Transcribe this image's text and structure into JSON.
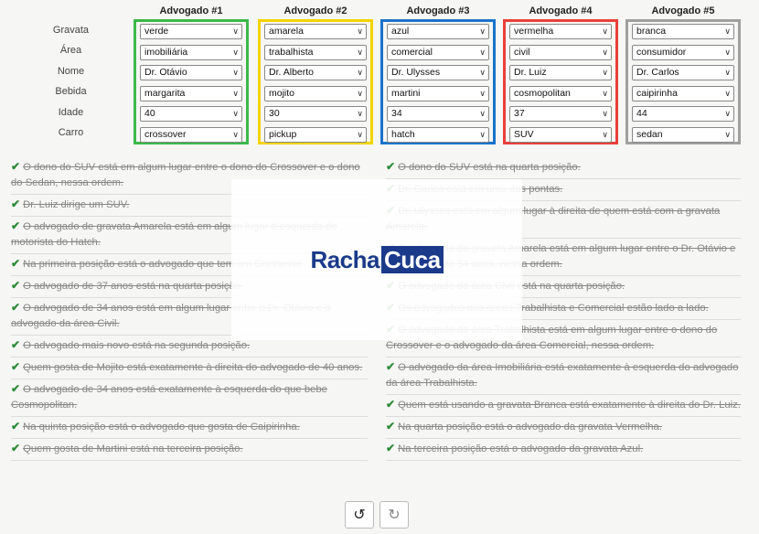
{
  "row_labels": [
    "Gravata",
    "Área",
    "Nome",
    "Bebida",
    "Idade",
    "Carro"
  ],
  "columns": [
    {
      "title": "Advogado #1",
      "color": "#3cb84a",
      "values": [
        "verde",
        "imobiliária",
        "Dr. Otávio",
        "margarita",
        "40",
        "crossover"
      ]
    },
    {
      "title": "Advogado #2",
      "color": "#f2d400",
      "values": [
        "amarela",
        "trabalhista",
        "Dr. Alberto",
        "mojito",
        "30",
        "pickup"
      ]
    },
    {
      "title": "Advogado #3",
      "color": "#1a72c9",
      "values": [
        "azul",
        "comercial",
        "Dr. Ulysses",
        "martini",
        "34",
        "hatch"
      ]
    },
    {
      "title": "Advogado #4",
      "color": "#e8403a",
      "values": [
        "vermelha",
        "civil",
        "Dr. Luiz",
        "cosmopolitan",
        "37",
        "SUV"
      ]
    },
    {
      "title": "Advogado #5",
      "color": "#a0a0a0",
      "values": [
        "branca",
        "consumidor",
        "Dr. Carlos",
        "caipirinha",
        "44",
        "sedan"
      ]
    }
  ],
  "clues_left": [
    "O dono do SUV está em algum lugar entre o dono do Crossover e o dono do Sedan, nessa ordem.",
    "Dr. Luiz dirige um SUV.",
    "O advogado de gravata Amarela está em algum lugar à esquerda do motorista do Hatch.",
    "Na primeira posição está o advogado que tem um Crossover.",
    "O advogado de 37 anos está na quarta posição.",
    "O advogado de 34 anos está em algum lugar entre o Dr. Otávio e o advogado da área Civil.",
    "O advogado mais novo está na segunda posição.",
    "Quem gosta de Mojito está exatamente à direita do advogado de 40 anos.",
    "O advogado de 34 anos está exatamente à esquerda do que bebe Cosmopolitan.",
    "Na quinta posição está o advogado que gosta de Caipirinha.",
    "Quem gosta de Martini está na terceira posição."
  ],
  "clues_right": [
    "O dono do SUV está na quarta posição.",
    "Dr. Carlos está em uma das pontas.",
    "Dr. Ulysses está em algum lugar à direita de quem está com a gravata Amarela.",
    "O advogado da gravata Amarela está em algum lugar entre o Dr. Otávio e o advogado de 34 anos, nessa ordem.",
    "O advogado da área Civil está na quarta posição.",
    "Os advogados das áreas Trabalhista e Comercial estão lado a lado.",
    "O advogado da área Trabalhista está em algum lugar entre o dono do Crossover e o advogado da área Comercial, nessa ordem.",
    "O advogado da área Imobiliária está exatamente à esquerda do advogado da área Trabalhista.",
    "Quem está usando a gravata Branca está exatamente à direita do Dr. Luiz.",
    "Na quarta posição está o advogado da gravata Vermelha.",
    "Na terceira posição está o advogado da gravata Azul."
  ],
  "logo": {
    "part1": "Racha",
    "part2": "Cuca"
  },
  "buttons": {
    "undo_icon": "undo-icon",
    "redo_icon": "redo-icon"
  }
}
